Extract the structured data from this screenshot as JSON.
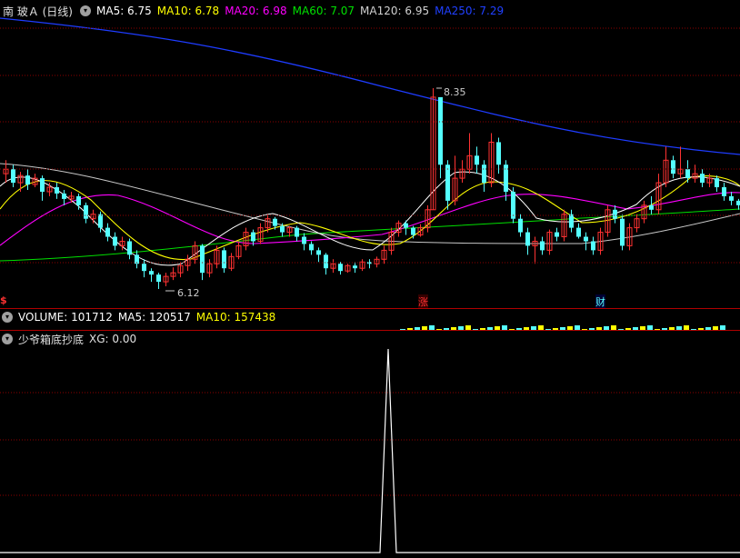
{
  "main_header": {
    "title": "南 玻Ａ (日线)",
    "ma5": "MA5: 6.75",
    "ma10": "MA10: 6.78",
    "ma20": "MA20: 6.98",
    "ma60": "MA60: 7.07",
    "ma120": "MA120: 6.95",
    "ma250": "MA250: 7.29"
  },
  "price_labels": {
    "high": "8.35",
    "low": "6.12"
  },
  "markers": {
    "left": "$",
    "zhang": "涨",
    "cai": "财"
  },
  "volume_header": {
    "volume": "VOLUME: 101712",
    "ma5": "MA5: 120517",
    "ma10": "MA10: 157438"
  },
  "indicator_header": {
    "name": "少爷箱底抄底",
    "xg": "XG: 0.00"
  },
  "colors": {
    "up": "#ff3232",
    "down": "#54ffff",
    "ma5": "#ffffff",
    "ma10": "#ffff00",
    "ma20": "#ff00ff",
    "ma60": "#00e000",
    "ma120": "#c8c8c8",
    "ma250": "#1e3cff",
    "grid": "#8b0000"
  },
  "chart_data": {
    "type": "candlestick",
    "title": "南 玻Ａ (日线)",
    "annotated_high": 8.35,
    "annotated_low": 6.12,
    "moving_averages_latest": {
      "MA5": 6.75,
      "MA10": 6.78,
      "MA20": 6.98,
      "MA60": 7.07,
      "MA120": 6.95,
      "MA250": 7.29
    },
    "volume_latest": {
      "VOLUME": 101712,
      "MA5": 120517,
      "MA10": 157438
    },
    "indicator_latest": {
      "XG": 0.0
    }
  }
}
